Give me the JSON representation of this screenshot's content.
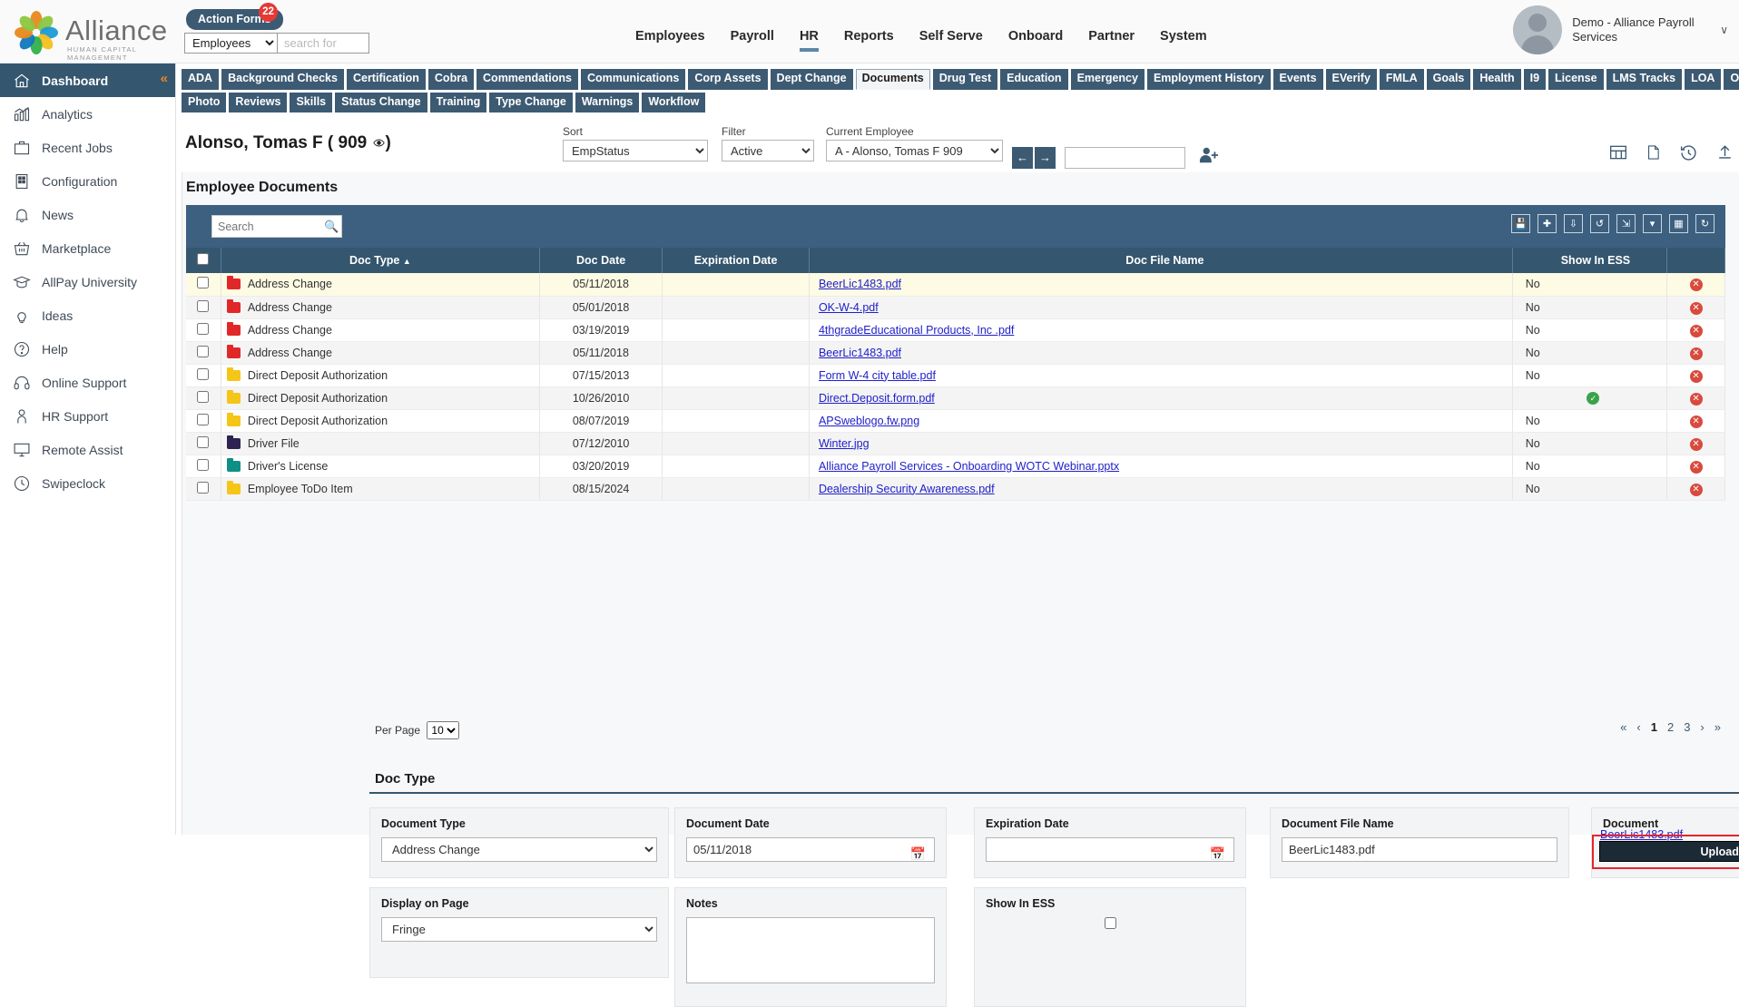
{
  "brand": {
    "name": "Alliance",
    "tagline": "HUMAN CAPITAL MANAGEMENT"
  },
  "topbar": {
    "action_forms_label": "Action Forms",
    "action_forms_count": "22",
    "search_scope": "Employees",
    "search_placeholder": "search for",
    "user_name": "Demo - Alliance Payroll Services",
    "caret": "∨"
  },
  "mainnav": {
    "items": [
      {
        "label": "Employees",
        "active": false
      },
      {
        "label": "Payroll",
        "active": false
      },
      {
        "label": "HR",
        "active": true
      },
      {
        "label": "Reports",
        "active": false
      },
      {
        "label": "Self Serve",
        "active": false
      },
      {
        "label": "Onboard",
        "active": false
      },
      {
        "label": "Partner",
        "active": false
      },
      {
        "label": "System",
        "active": false
      }
    ]
  },
  "sidebar": {
    "collapse": "«",
    "items": [
      {
        "label": "Dashboard",
        "icon": "home-icon",
        "active": true
      },
      {
        "label": "Analytics",
        "icon": "analytics-icon",
        "active": false
      },
      {
        "label": "Recent Jobs",
        "icon": "briefcase-icon",
        "active": false
      },
      {
        "label": "Configuration",
        "icon": "building-icon",
        "active": false
      },
      {
        "label": "News",
        "icon": "bell-icon",
        "active": false
      },
      {
        "label": "Marketplace",
        "icon": "basket-icon",
        "active": false
      },
      {
        "label": "AllPay University",
        "icon": "graduation-cap-icon",
        "active": false
      },
      {
        "label": "Ideas",
        "icon": "lightbulb-icon",
        "active": false
      },
      {
        "label": "Help",
        "icon": "question-circle-icon",
        "active": false
      },
      {
        "label": "Online Support",
        "icon": "headset-icon",
        "active": false
      },
      {
        "label": "HR Support",
        "icon": "person-icon",
        "active": false
      },
      {
        "label": "Remote Assist",
        "icon": "monitor-icon",
        "active": false
      },
      {
        "label": "Swipeclock",
        "icon": "clock-icon",
        "active": false
      }
    ]
  },
  "tabs": {
    "row1": [
      {
        "label": "ADA",
        "active": false
      },
      {
        "label": "Background Checks",
        "active": false
      },
      {
        "label": "Certification",
        "active": false
      },
      {
        "label": "Cobra",
        "active": false
      },
      {
        "label": "Commendations",
        "active": false
      },
      {
        "label": "Communications",
        "active": false
      },
      {
        "label": "Corp Assets",
        "active": false
      },
      {
        "label": "Dept Change",
        "active": false
      },
      {
        "label": "Documents",
        "active": true
      },
      {
        "label": "Drug Test",
        "active": false
      },
      {
        "label": "Education",
        "active": false
      },
      {
        "label": "Emergency",
        "active": false
      },
      {
        "label": "Employment History",
        "active": false
      },
      {
        "label": "Events",
        "active": false
      },
      {
        "label": "EVerify",
        "active": false
      },
      {
        "label": "FMLA",
        "active": false
      },
      {
        "label": "Goals",
        "active": false
      },
      {
        "label": "Health",
        "active": false
      },
      {
        "label": "I9",
        "active": false
      },
      {
        "label": "License",
        "active": false
      },
      {
        "label": "LMS Tracks",
        "active": false
      },
      {
        "label": "LOA",
        "active": false
      },
      {
        "label": "OSHA",
        "active": false
      }
    ],
    "row2": [
      {
        "label": "Photo",
        "active": false
      },
      {
        "label": "Reviews",
        "active": false
      },
      {
        "label": "Skills",
        "active": false
      },
      {
        "label": "Status Change",
        "active": false
      },
      {
        "label": "Training",
        "active": false
      },
      {
        "label": "Type Change",
        "active": false
      },
      {
        "label": "Warnings",
        "active": false
      },
      {
        "label": "Workflow",
        "active": false
      }
    ]
  },
  "employee_header": {
    "name": "Alonso, Tomas F ( 909 ",
    "name_suffix": ")",
    "eye_icon": "eye-icon",
    "sort_label": "Sort",
    "sort_value": "EmpStatus",
    "filter_label": "Filter",
    "filter_value": "Active",
    "current_label": "Current Employee",
    "current_value": "A - Alonso, Tomas F 909",
    "prev_icon": "←",
    "next_icon": "→",
    "search_placeholder": "",
    "add_user_icon": "add-user-icon"
  },
  "panel": {
    "title": "Employee Documents",
    "grid_search_placeholder": "Search"
  },
  "table": {
    "columns": [
      "",
      "Doc Type",
      "Doc Date",
      "Expiration Date",
      "Doc File Name",
      "Show In ESS",
      ""
    ],
    "sort_indicator": "▲",
    "rows": [
      {
        "type": "Address Change",
        "color": "#e12828",
        "date": "05/11/2018",
        "exp": "",
        "file": "BeerLic1483.pdf",
        "ess": "No",
        "ess_ok": false,
        "highlight": true
      },
      {
        "type": "Address Change",
        "color": "#e12828",
        "date": "05/01/2018",
        "exp": "",
        "file": "OK-W-4.pdf",
        "ess": "No",
        "ess_ok": false,
        "highlight": false
      },
      {
        "type": "Address Change",
        "color": "#e12828",
        "date": "03/19/2019",
        "exp": "",
        "file": "4thgradeEducational Products, Inc .pdf",
        "ess": "No",
        "ess_ok": false,
        "highlight": false
      },
      {
        "type": "Address Change",
        "color": "#e12828",
        "date": "05/11/2018",
        "exp": "",
        "file": "BeerLic1483.pdf",
        "ess": "No",
        "ess_ok": false,
        "highlight": false
      },
      {
        "type": "Direct Deposit Authorization",
        "color": "#f5c518",
        "date": "07/15/2013",
        "exp": "",
        "file": "Form W-4 city table.pdf",
        "ess": "No",
        "ess_ok": false,
        "highlight": false
      },
      {
        "type": "Direct Deposit Authorization",
        "color": "#f5c518",
        "date": "10/26/2010",
        "exp": "",
        "file": "Direct.Deposit.form.pdf",
        "ess": "",
        "ess_ok": true,
        "highlight": false
      },
      {
        "type": "Direct Deposit Authorization",
        "color": "#f5c518",
        "date": "08/07/2019",
        "exp": "",
        "file": "APSweblogo.fw.png",
        "ess": "No",
        "ess_ok": false,
        "highlight": false
      },
      {
        "type": "Driver File",
        "color": "#2d2250",
        "date": "07/12/2010",
        "exp": "",
        "file": "Winter.jpg",
        "ess": "No",
        "ess_ok": false,
        "highlight": false
      },
      {
        "type": "Driver's License",
        "color": "#0f8f86",
        "date": "03/20/2019",
        "exp": "",
        "file": "Alliance Payroll Services - Onboarding WOTC Webinar.pptx",
        "ess": "No",
        "ess_ok": false,
        "highlight": false
      },
      {
        "type": "Employee ToDo Item",
        "color": "#f5c518",
        "date": "08/15/2024",
        "exp": "",
        "file": "Dealership Security Awareness.pdf",
        "ess": "No",
        "ess_ok": false,
        "highlight": false
      }
    ]
  },
  "pagination": {
    "per_page_label": "Per Page",
    "per_page_value": "10",
    "first": "«",
    "prev": "‹",
    "pages": [
      "1",
      "2",
      "3"
    ],
    "current_page": "1",
    "next": "›",
    "last": "»"
  },
  "form": {
    "section_title": "Doc Type",
    "document_type_label": "Document Type",
    "document_type_value": "Address Change",
    "document_date_label": "Document Date",
    "document_date_value": "05/11/2018",
    "expiration_date_label": "Expiration Date",
    "expiration_date_value": "",
    "document_file_name_label": "Document File Name",
    "document_file_name_value": "BeerLic1483.pdf",
    "document_label": "Document",
    "document_preview_name": "BeerLic1483.pdf",
    "upload_button_label": "Upload Document",
    "display_on_page_label": "Display on Page",
    "display_on_page_value": "Fringe",
    "notes_label": "Notes",
    "notes_value": "",
    "show_in_ess_label": "Show In ESS"
  },
  "colors": {
    "primary": "#34566f",
    "tab": "#3d5a73",
    "accent": "#e8891f",
    "danger": "#e8232a"
  }
}
